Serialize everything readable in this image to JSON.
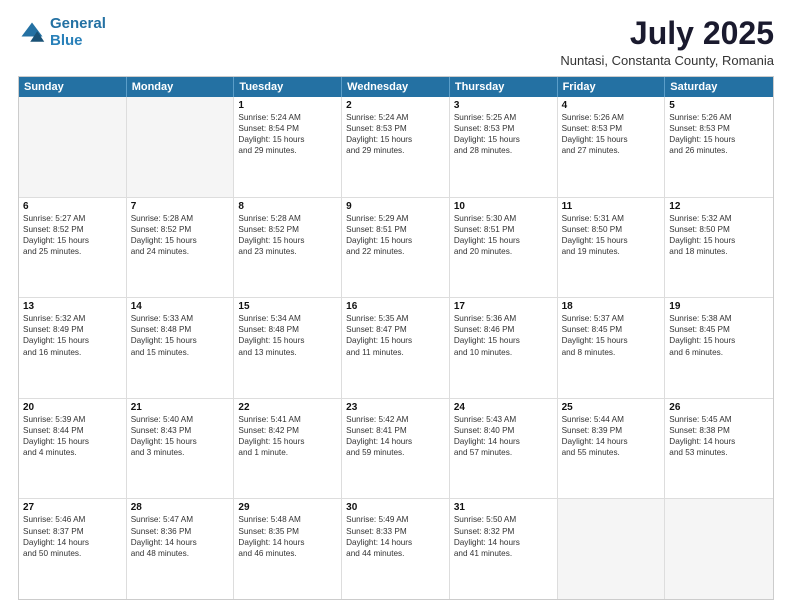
{
  "header": {
    "logo_general": "General",
    "logo_blue": "Blue",
    "title": "July 2025",
    "subtitle": "Nuntasi, Constanta County, Romania"
  },
  "weekdays": [
    "Sunday",
    "Monday",
    "Tuesday",
    "Wednesday",
    "Thursday",
    "Friday",
    "Saturday"
  ],
  "rows": [
    [
      {
        "day": "",
        "lines": [],
        "empty": true
      },
      {
        "day": "",
        "lines": [],
        "empty": true
      },
      {
        "day": "1",
        "lines": [
          "Sunrise: 5:24 AM",
          "Sunset: 8:54 PM",
          "Daylight: 15 hours",
          "and 29 minutes."
        ]
      },
      {
        "day": "2",
        "lines": [
          "Sunrise: 5:24 AM",
          "Sunset: 8:53 PM",
          "Daylight: 15 hours",
          "and 29 minutes."
        ]
      },
      {
        "day": "3",
        "lines": [
          "Sunrise: 5:25 AM",
          "Sunset: 8:53 PM",
          "Daylight: 15 hours",
          "and 28 minutes."
        ]
      },
      {
        "day": "4",
        "lines": [
          "Sunrise: 5:26 AM",
          "Sunset: 8:53 PM",
          "Daylight: 15 hours",
          "and 27 minutes."
        ]
      },
      {
        "day": "5",
        "lines": [
          "Sunrise: 5:26 AM",
          "Sunset: 8:53 PM",
          "Daylight: 15 hours",
          "and 26 minutes."
        ]
      }
    ],
    [
      {
        "day": "6",
        "lines": [
          "Sunrise: 5:27 AM",
          "Sunset: 8:52 PM",
          "Daylight: 15 hours",
          "and 25 minutes."
        ]
      },
      {
        "day": "7",
        "lines": [
          "Sunrise: 5:28 AM",
          "Sunset: 8:52 PM",
          "Daylight: 15 hours",
          "and 24 minutes."
        ]
      },
      {
        "day": "8",
        "lines": [
          "Sunrise: 5:28 AM",
          "Sunset: 8:52 PM",
          "Daylight: 15 hours",
          "and 23 minutes."
        ]
      },
      {
        "day": "9",
        "lines": [
          "Sunrise: 5:29 AM",
          "Sunset: 8:51 PM",
          "Daylight: 15 hours",
          "and 22 minutes."
        ]
      },
      {
        "day": "10",
        "lines": [
          "Sunrise: 5:30 AM",
          "Sunset: 8:51 PM",
          "Daylight: 15 hours",
          "and 20 minutes."
        ]
      },
      {
        "day": "11",
        "lines": [
          "Sunrise: 5:31 AM",
          "Sunset: 8:50 PM",
          "Daylight: 15 hours",
          "and 19 minutes."
        ]
      },
      {
        "day": "12",
        "lines": [
          "Sunrise: 5:32 AM",
          "Sunset: 8:50 PM",
          "Daylight: 15 hours",
          "and 18 minutes."
        ]
      }
    ],
    [
      {
        "day": "13",
        "lines": [
          "Sunrise: 5:32 AM",
          "Sunset: 8:49 PM",
          "Daylight: 15 hours",
          "and 16 minutes."
        ]
      },
      {
        "day": "14",
        "lines": [
          "Sunrise: 5:33 AM",
          "Sunset: 8:48 PM",
          "Daylight: 15 hours",
          "and 15 minutes."
        ]
      },
      {
        "day": "15",
        "lines": [
          "Sunrise: 5:34 AM",
          "Sunset: 8:48 PM",
          "Daylight: 15 hours",
          "and 13 minutes."
        ]
      },
      {
        "day": "16",
        "lines": [
          "Sunrise: 5:35 AM",
          "Sunset: 8:47 PM",
          "Daylight: 15 hours",
          "and 11 minutes."
        ]
      },
      {
        "day": "17",
        "lines": [
          "Sunrise: 5:36 AM",
          "Sunset: 8:46 PM",
          "Daylight: 15 hours",
          "and 10 minutes."
        ]
      },
      {
        "day": "18",
        "lines": [
          "Sunrise: 5:37 AM",
          "Sunset: 8:45 PM",
          "Daylight: 15 hours",
          "and 8 minutes."
        ]
      },
      {
        "day": "19",
        "lines": [
          "Sunrise: 5:38 AM",
          "Sunset: 8:45 PM",
          "Daylight: 15 hours",
          "and 6 minutes."
        ]
      }
    ],
    [
      {
        "day": "20",
        "lines": [
          "Sunrise: 5:39 AM",
          "Sunset: 8:44 PM",
          "Daylight: 15 hours",
          "and 4 minutes."
        ]
      },
      {
        "day": "21",
        "lines": [
          "Sunrise: 5:40 AM",
          "Sunset: 8:43 PM",
          "Daylight: 15 hours",
          "and 3 minutes."
        ]
      },
      {
        "day": "22",
        "lines": [
          "Sunrise: 5:41 AM",
          "Sunset: 8:42 PM",
          "Daylight: 15 hours",
          "and 1 minute."
        ]
      },
      {
        "day": "23",
        "lines": [
          "Sunrise: 5:42 AM",
          "Sunset: 8:41 PM",
          "Daylight: 14 hours",
          "and 59 minutes."
        ]
      },
      {
        "day": "24",
        "lines": [
          "Sunrise: 5:43 AM",
          "Sunset: 8:40 PM",
          "Daylight: 14 hours",
          "and 57 minutes."
        ]
      },
      {
        "day": "25",
        "lines": [
          "Sunrise: 5:44 AM",
          "Sunset: 8:39 PM",
          "Daylight: 14 hours",
          "and 55 minutes."
        ]
      },
      {
        "day": "26",
        "lines": [
          "Sunrise: 5:45 AM",
          "Sunset: 8:38 PM",
          "Daylight: 14 hours",
          "and 53 minutes."
        ]
      }
    ],
    [
      {
        "day": "27",
        "lines": [
          "Sunrise: 5:46 AM",
          "Sunset: 8:37 PM",
          "Daylight: 14 hours",
          "and 50 minutes."
        ]
      },
      {
        "day": "28",
        "lines": [
          "Sunrise: 5:47 AM",
          "Sunset: 8:36 PM",
          "Daylight: 14 hours",
          "and 48 minutes."
        ]
      },
      {
        "day": "29",
        "lines": [
          "Sunrise: 5:48 AM",
          "Sunset: 8:35 PM",
          "Daylight: 14 hours",
          "and 46 minutes."
        ]
      },
      {
        "day": "30",
        "lines": [
          "Sunrise: 5:49 AM",
          "Sunset: 8:33 PM",
          "Daylight: 14 hours",
          "and 44 minutes."
        ]
      },
      {
        "day": "31",
        "lines": [
          "Sunrise: 5:50 AM",
          "Sunset: 8:32 PM",
          "Daylight: 14 hours",
          "and 41 minutes."
        ]
      },
      {
        "day": "",
        "lines": [],
        "empty": true
      },
      {
        "day": "",
        "lines": [],
        "empty": true
      }
    ]
  ]
}
